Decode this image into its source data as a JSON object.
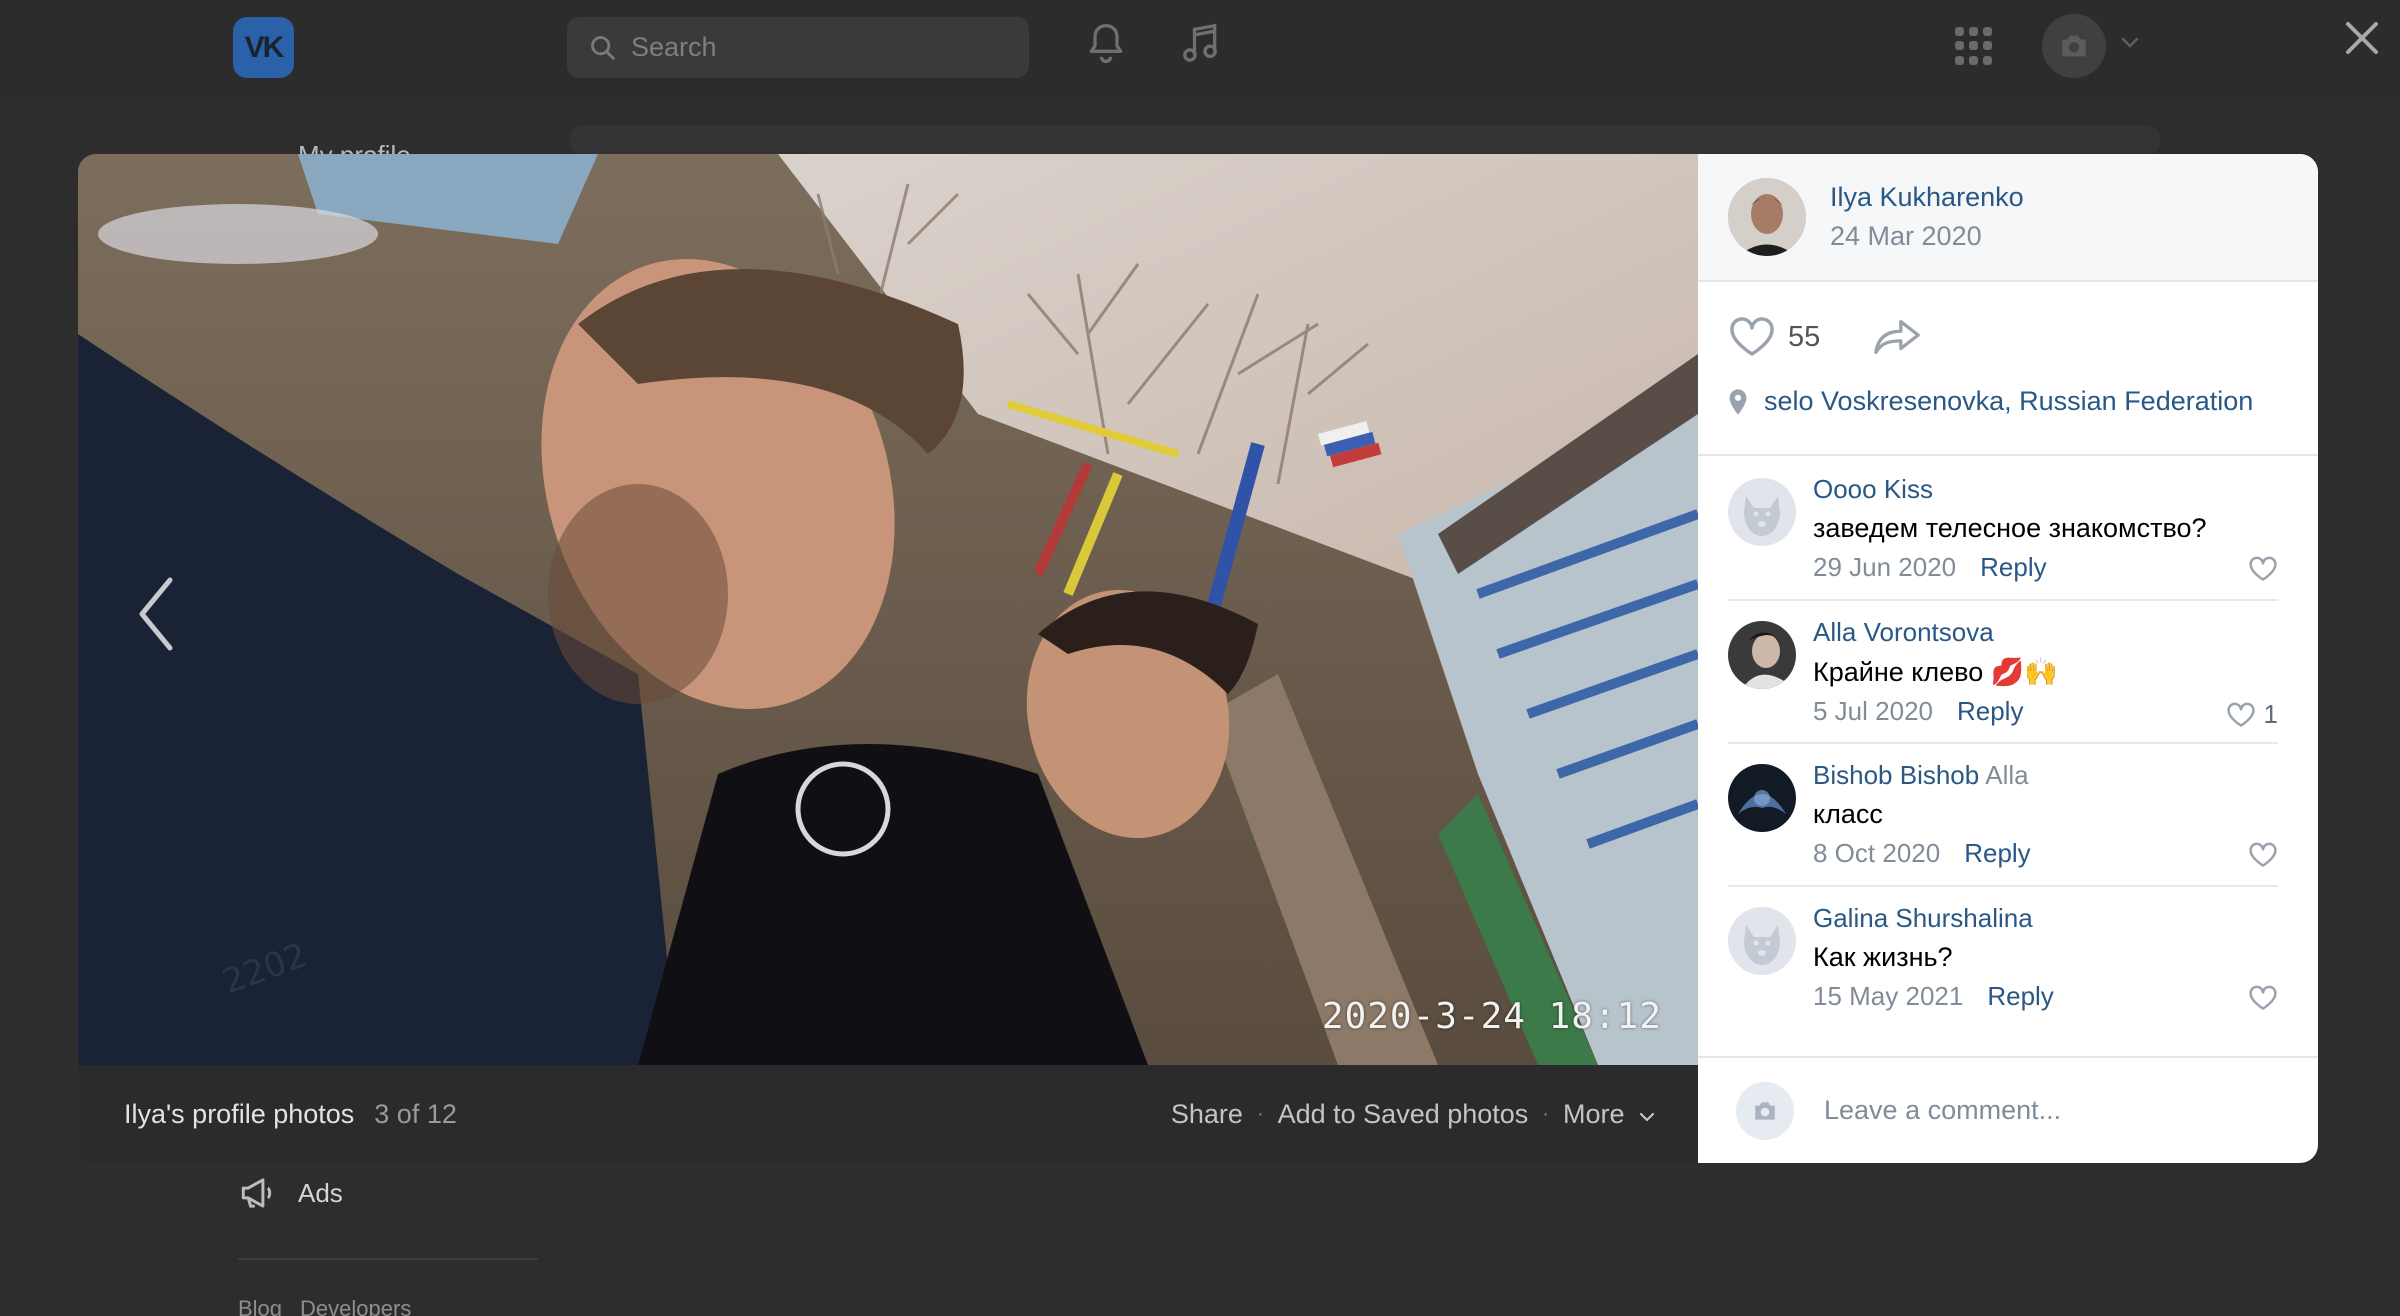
{
  "header": {
    "logo_text": "VK",
    "search_placeholder": "Search",
    "icons": [
      "search-icon",
      "bell-icon",
      "music-icon",
      "apps-icon",
      "camera-icon",
      "chevron-down-icon",
      "close-icon"
    ]
  },
  "background": {
    "menu_partial": "My profile",
    "ads_label": "Ads",
    "footer_links": [
      "Blog",
      "Developers"
    ]
  },
  "photo": {
    "timestamp_overlay": "2020-3-24 18:12",
    "album_title": "Ilya's profile photos",
    "counter": "3 of 12",
    "actions": [
      "Share",
      "Add to Saved photos",
      "More"
    ],
    "separator": "·"
  },
  "post": {
    "author": "Ilya Kukharenko",
    "date": "24 Mar 2020",
    "likes": "55",
    "location": "selo Voskresenovka, Russian Federation"
  },
  "comments": [
    {
      "name": "Oooo Kiss",
      "reply_to": "",
      "text": "заведем телесное знакомство?",
      "date": "29 Jun 2020",
      "reply_label": "Reply",
      "likes": ""
    },
    {
      "name": "Alla Vorontsova",
      "reply_to": "",
      "text": "Крайне клево 💋🙌",
      "date": "5 Jul 2020",
      "reply_label": "Reply",
      "likes": "1"
    },
    {
      "name": "Bishob Bishob",
      "reply_to": "Alla",
      "text": "класс",
      "date": "8 Oct 2020",
      "reply_label": "Reply",
      "likes": ""
    },
    {
      "name": "Galina Shurshalina",
      "reply_to": "",
      "text": "Как жизнь?",
      "date": "15 May 2021",
      "reply_label": "Reply",
      "likes": ""
    }
  ],
  "composer": {
    "placeholder": "Leave a comment..."
  },
  "colors": {
    "link": "#2a5885",
    "muted": "#818c99",
    "overlay": "#2d2d2e",
    "brand": "#2b61a8"
  }
}
